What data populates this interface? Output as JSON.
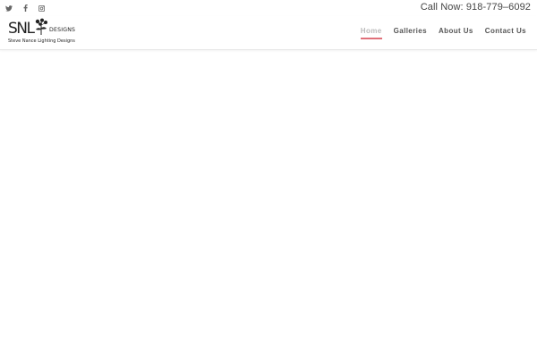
{
  "topbar": {
    "social": [
      {
        "icon": "twitter-icon"
      },
      {
        "icon": "facebook-icon"
      },
      {
        "icon": "instagram-icon"
      }
    ],
    "call_text": "Call Now: 918-779–6092"
  },
  "logo": {
    "mark": "SNL",
    "designs": "DESIGNS",
    "tagline": "Steve Nance Lighting Designs"
  },
  "nav": {
    "items": [
      {
        "label": "Home",
        "active": true
      },
      {
        "label": "Galleries",
        "active": false
      },
      {
        "label": "About Us",
        "active": false
      },
      {
        "label": "Contact Us",
        "active": false
      }
    ],
    "accent_color": "#e0707a"
  }
}
